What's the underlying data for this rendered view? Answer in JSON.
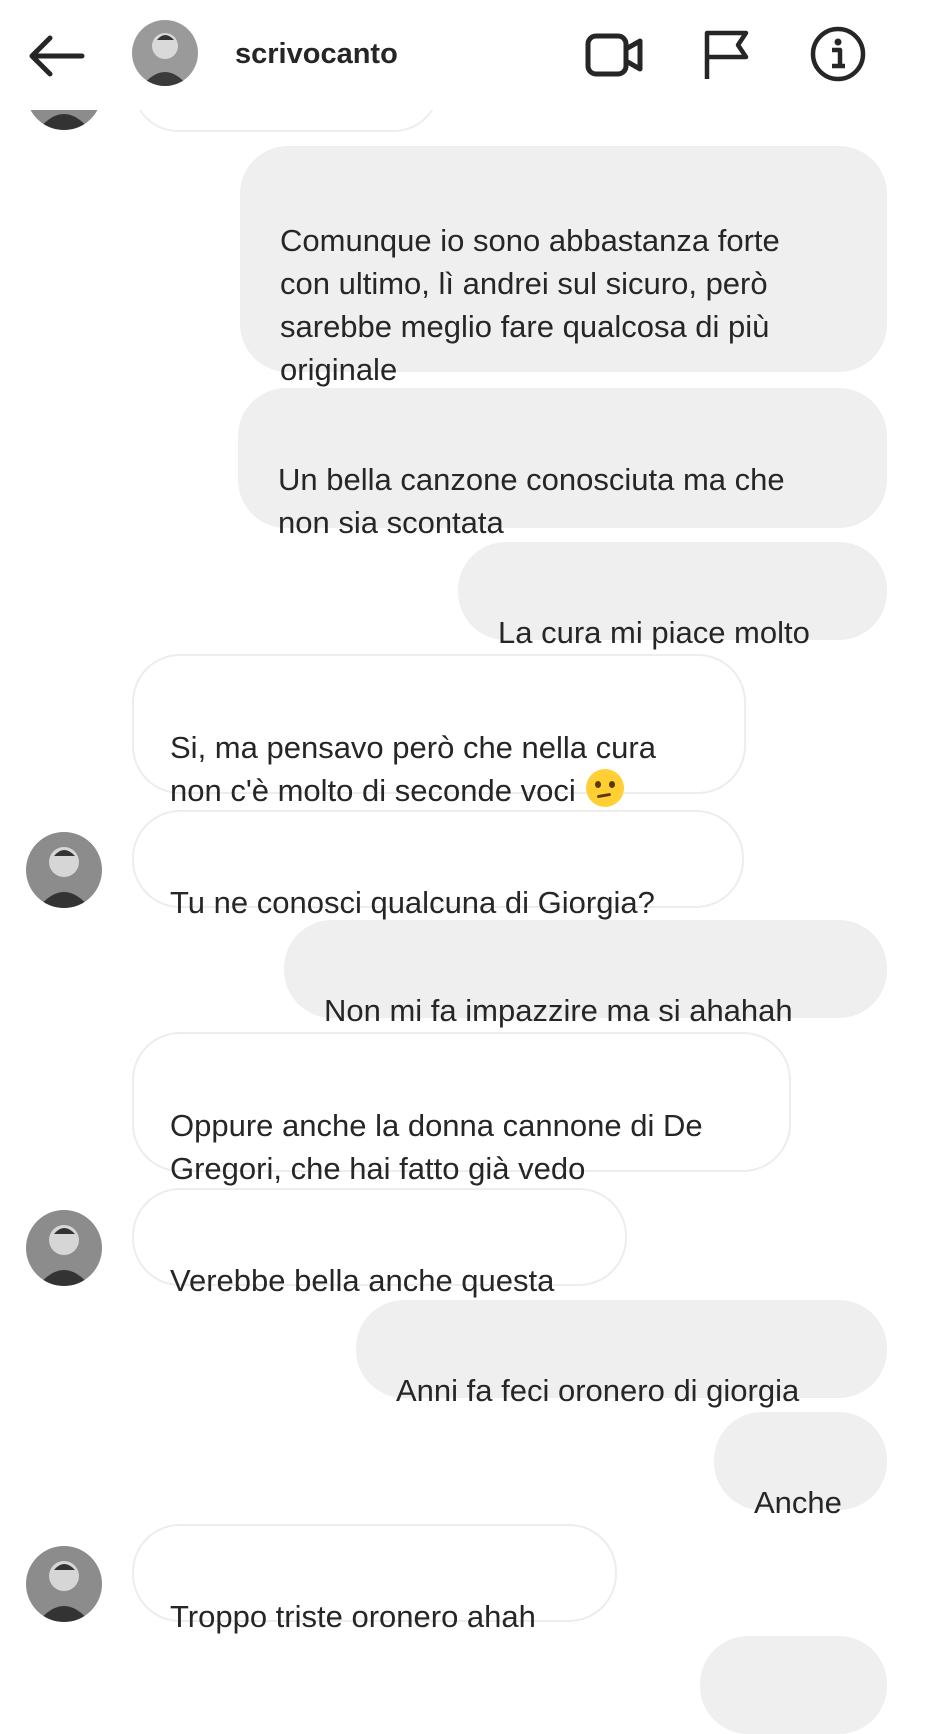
{
  "header": {
    "username": "scrivocanto",
    "back_icon": "arrow-left-icon",
    "video_icon": "video-camera-icon",
    "flag_icon": "flag-icon",
    "info_icon": "info-icon"
  },
  "messages": [
    {
      "side": "out",
      "text": "Comunque io sono abbastanza forte\ncon ultimo, lì andrei sul sicuro, però\nsarebbe meglio fare qualcosa di più\noriginale"
    },
    {
      "side": "out",
      "text": "Un bella canzone conosciuta ma che\nnon sia scontata"
    },
    {
      "side": "out",
      "text": "La cura mi piace molto"
    },
    {
      "side": "in",
      "text": "Si, ma pensavo però che nella cura\nnon c'è molto di seconde voci",
      "emoji": "thinking-face-emoji"
    },
    {
      "side": "in",
      "text": "Tu ne conosci qualcuna di Giorgia?"
    },
    {
      "side": "out",
      "text": "Non mi fa impazzire ma si ahahah"
    },
    {
      "side": "in",
      "text": "Oppure anche la donna cannone di De\nGregori, che hai fatto già vedo"
    },
    {
      "side": "in",
      "text": "Verebbe bella anche questa"
    },
    {
      "side": "out",
      "text": "Anni fa feci oronero di giorgia"
    },
    {
      "side": "out",
      "text": "Anche"
    },
    {
      "side": "in",
      "text": "Troppo triste oronero ahah"
    }
  ],
  "colors": {
    "outgoing_bubble": "#efefef",
    "incoming_border": "#ededed",
    "text": "#262626"
  }
}
